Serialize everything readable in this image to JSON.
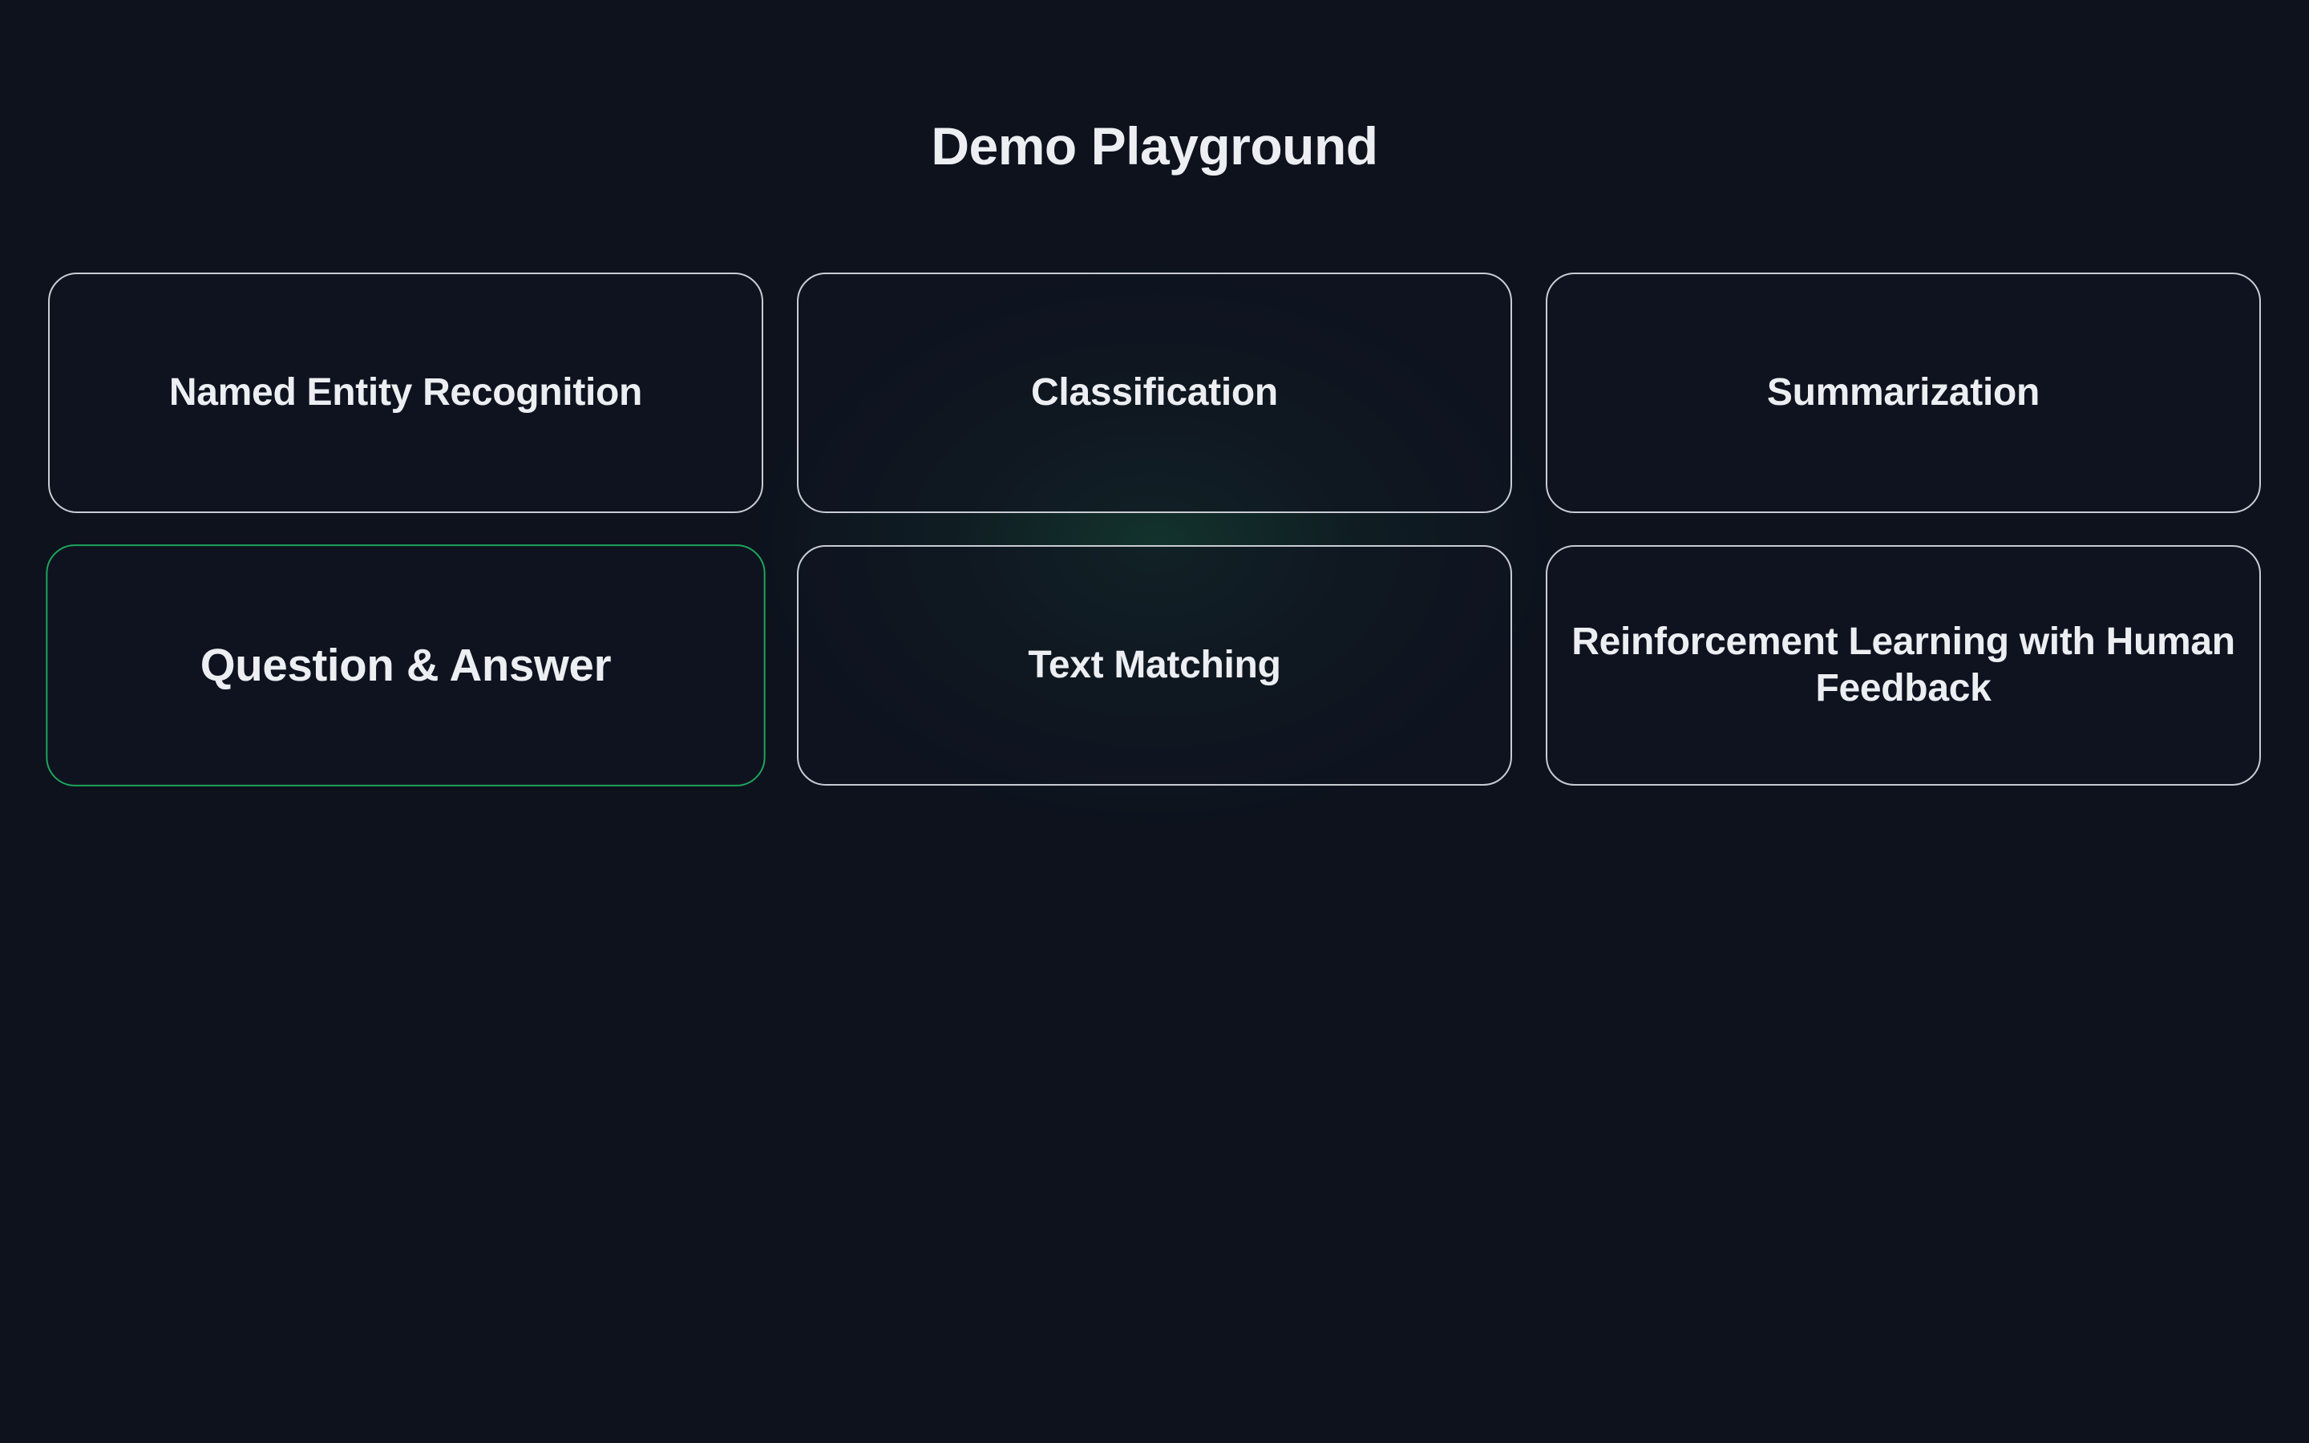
{
  "page": {
    "title": "Demo Playground"
  },
  "cards": [
    {
      "label": "Named Entity Recognition",
      "active": false
    },
    {
      "label": "Classification",
      "active": false
    },
    {
      "label": "Summarization",
      "active": false
    },
    {
      "label": "Question & Answer",
      "active": true
    },
    {
      "label": "Text Matching",
      "active": false
    },
    {
      "label": "Reinforcement Learning with Human Feedback",
      "active": false
    }
  ],
  "colors": {
    "background": "#0d121d",
    "card_border": "#c9ccd3",
    "active_border": "#1fa35c",
    "text": "#eceef2"
  }
}
